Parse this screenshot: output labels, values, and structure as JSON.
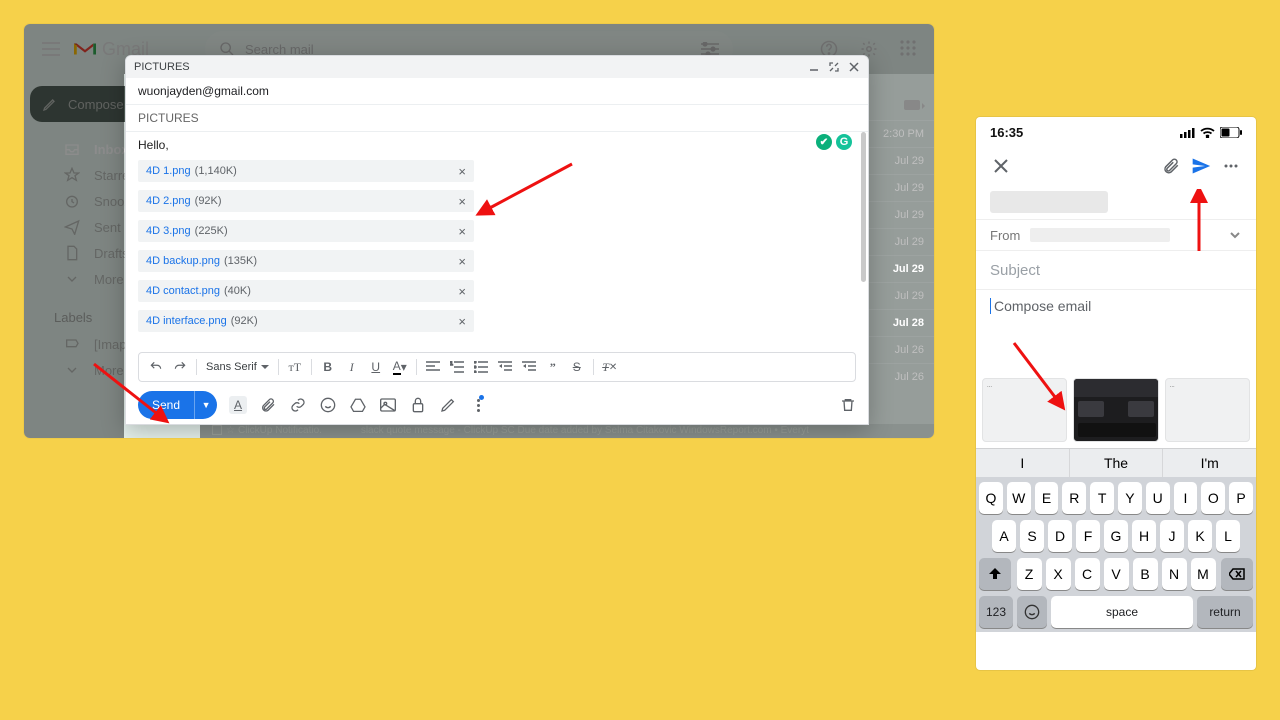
{
  "topbar": {
    "brand": "Gmail",
    "search_placeholder": "Search mail"
  },
  "sidebar": {
    "compose": "Compose",
    "items": [
      "Inbox",
      "Starred",
      "Snoozed",
      "Sent",
      "Drafts",
      "More"
    ],
    "labels_hdr": "Labels",
    "label_items": [
      "[Imap]/Drafts",
      "More"
    ]
  },
  "rightlist": {
    "items": [
      {
        "text": "2:30 PM",
        "bold": false
      },
      {
        "text": "Jul 29",
        "bold": false
      },
      {
        "text": "Jul 29",
        "bold": false
      },
      {
        "text": "Jul 29",
        "bold": false
      },
      {
        "text": "Jul 29",
        "bold": false
      },
      {
        "text": "Jul 29",
        "bold": true
      },
      {
        "text": "Jul 29",
        "bold": false
      },
      {
        "text": "Jul 28",
        "bold": true
      },
      {
        "text": "Jul 26",
        "bold": false
      },
      {
        "text": "Jul 26",
        "bold": false
      }
    ]
  },
  "snippet": {
    "sender": "ClickUp Notificatio.",
    "text": "slack quote message - ClickUp SC Due date added by Selma Citakovic WindowsReport.com • Everyt"
  },
  "compose": {
    "title": "PICTURES",
    "to": "wuonjayden@gmail.com",
    "subject": "PICTURES",
    "body": "Hello,",
    "attachments": [
      {
        "name": "4D 1.png",
        "size": "(1,140K)"
      },
      {
        "name": "4D 2.png",
        "size": "(92K)"
      },
      {
        "name": "4D 3.png",
        "size": "(225K)"
      },
      {
        "name": "4D backup.png",
        "size": "(135K)"
      },
      {
        "name": "4D contact.png",
        "size": "(40K)"
      },
      {
        "name": "4D interface.png",
        "size": "(92K)"
      }
    ],
    "font": "Sans Serif",
    "send": "Send"
  },
  "phone": {
    "time": "16:35",
    "from_label": "From",
    "subject_ph": "Subject",
    "body_ph": "Compose email",
    "suggestions": [
      "I",
      "The",
      "I'm"
    ],
    "rows": [
      [
        "Q",
        "W",
        "E",
        "R",
        "T",
        "Y",
        "U",
        "I",
        "O",
        "P"
      ],
      [
        "A",
        "S",
        "D",
        "F",
        "G",
        "H",
        "J",
        "K",
        "L"
      ],
      [
        "Z",
        "X",
        "C",
        "V",
        "B",
        "N",
        "M"
      ]
    ],
    "k123": "123",
    "space": "space",
    "ret": "return"
  }
}
